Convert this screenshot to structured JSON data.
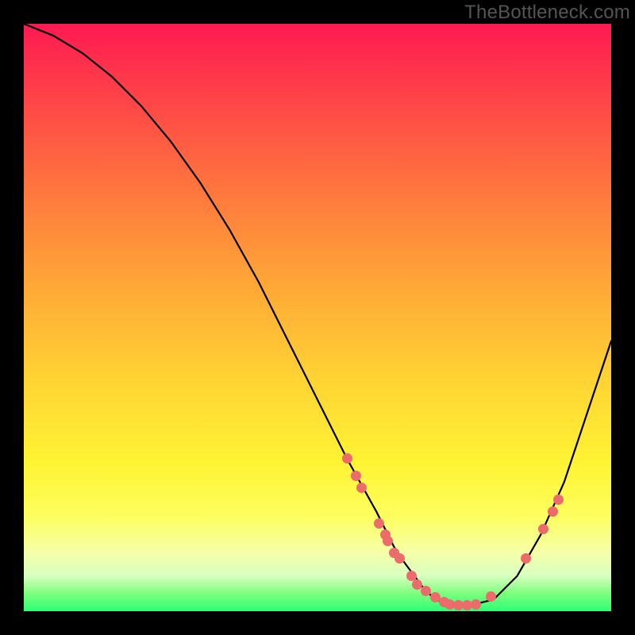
{
  "watermark": "TheBottleneck.com",
  "chart_data": {
    "type": "line",
    "title": "",
    "xlabel": "",
    "ylabel": "",
    "xlim": [
      0,
      100
    ],
    "ylim": [
      0,
      100
    ],
    "grid": false,
    "legend": false,
    "series": [
      {
        "name": "bottleneck-curve",
        "x": [
          0,
          5,
          10,
          15,
          20,
          25,
          30,
          35,
          40,
          45,
          50,
          55,
          60,
          63,
          65,
          68,
          70,
          73,
          76,
          80,
          84,
          88,
          92,
          96,
          100
        ],
        "y": [
          100,
          98,
          95,
          91,
          86,
          80,
          73,
          65,
          56,
          46,
          36,
          26,
          17,
          11,
          8,
          4,
          2,
          1,
          1,
          2,
          6,
          13,
          22,
          34,
          46
        ]
      }
    ],
    "markers": [
      {
        "x": 55.0,
        "y": 26.0
      },
      {
        "x": 56.5,
        "y": 23.0
      },
      {
        "x": 57.5,
        "y": 21.0
      },
      {
        "x": 60.5,
        "y": 15.0
      },
      {
        "x": 61.5,
        "y": 13.0
      },
      {
        "x": 62.0,
        "y": 12.0
      },
      {
        "x": 63.0,
        "y": 10.0
      },
      {
        "x": 64.0,
        "y": 9.0
      },
      {
        "x": 66.0,
        "y": 6.0
      },
      {
        "x": 67.0,
        "y": 4.5
      },
      {
        "x": 68.5,
        "y": 3.5
      },
      {
        "x": 70.0,
        "y": 2.3
      },
      {
        "x": 71.5,
        "y": 1.5
      },
      {
        "x": 72.5,
        "y": 1.2
      },
      {
        "x": 74.0,
        "y": 1.0
      },
      {
        "x": 75.5,
        "y": 1.0
      },
      {
        "x": 77.0,
        "y": 1.2
      },
      {
        "x": 79.5,
        "y": 2.5
      },
      {
        "x": 85.5,
        "y": 9.0
      },
      {
        "x": 88.5,
        "y": 14.0
      },
      {
        "x": 90.0,
        "y": 17.0
      },
      {
        "x": 91.0,
        "y": 19.0
      }
    ],
    "colors": {
      "curve": "#000000",
      "markers": "#ec6b6b",
      "gradient_top": "#ff1a52",
      "gradient_bottom": "#2cff76"
    }
  }
}
